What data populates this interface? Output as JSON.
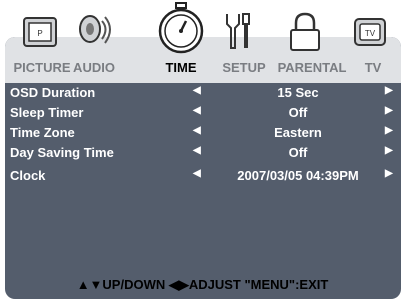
{
  "tabs": [
    {
      "label": "PICTURE",
      "icon": "picture-icon"
    },
    {
      "label": "AUDIO",
      "icon": "speaker-icon"
    },
    {
      "label": "TIME",
      "icon": "stopwatch-icon"
    },
    {
      "label": "SETUP",
      "icon": "tools-icon"
    },
    {
      "label": "PARENTAL",
      "icon": "lock-icon"
    },
    {
      "label": "TV",
      "icon": "tv-icon"
    }
  ],
  "active_tab": "TIME",
  "rows": [
    {
      "label": "OSD Duration",
      "value": "15 Sec"
    },
    {
      "label": "Sleep Timer",
      "value": "Off"
    },
    {
      "label": "Time Zone",
      "value": "Eastern"
    },
    {
      "label": "Day Saving Time",
      "value": "Off"
    },
    {
      "label": "Clock",
      "value": "2007/03/05 04:39PM"
    }
  ],
  "arrow_left": "◀",
  "arrow_right": "▶",
  "footer": "▲▼UP/DOWN  ◀▶ADJUST  \"MENU\":EXIT",
  "colors": {
    "panel": "#545d6c",
    "tab_bar": "#e0e2e5",
    "active": "#000000",
    "inactive": "#7a7d82"
  }
}
